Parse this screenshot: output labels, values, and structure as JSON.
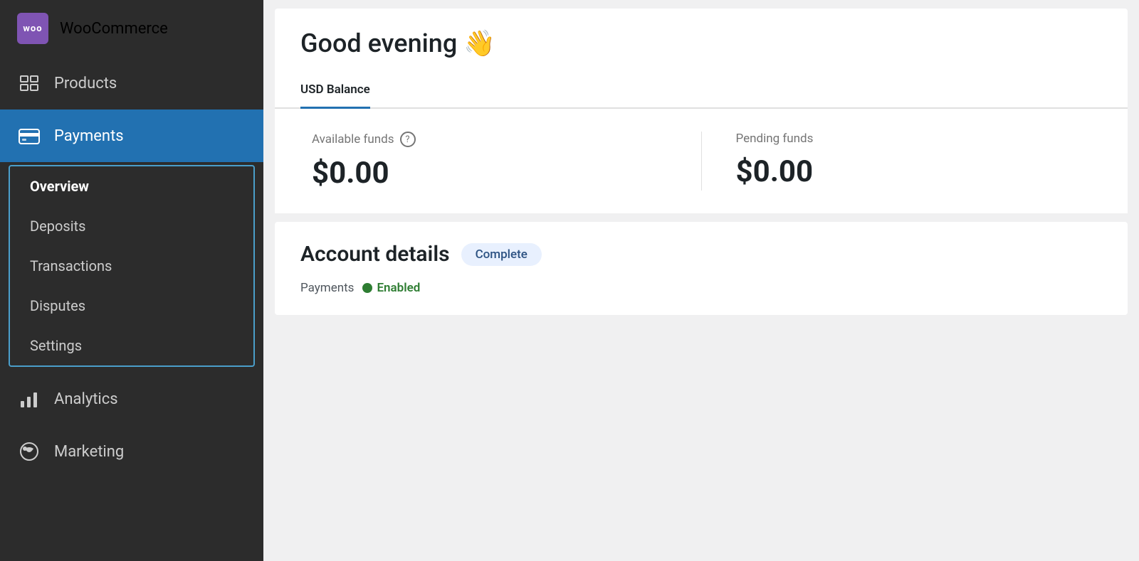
{
  "sidebar": {
    "logo": {
      "icon_label": "woo",
      "label": "WooCommerce"
    },
    "items": [
      {
        "id": "products",
        "label": "Products",
        "icon": "products-icon",
        "active": false
      },
      {
        "id": "payments",
        "label": "Payments",
        "icon": "payments-icon",
        "active": true
      },
      {
        "id": "analytics",
        "label": "Analytics",
        "icon": "analytics-icon",
        "active": false
      },
      {
        "id": "marketing",
        "label": "Marketing",
        "icon": "marketing-icon",
        "active": false
      }
    ],
    "submenu": {
      "items": [
        {
          "id": "overview",
          "label": "Overview",
          "active": true
        },
        {
          "id": "deposits",
          "label": "Deposits",
          "active": false
        },
        {
          "id": "transactions",
          "label": "Transactions",
          "active": false
        },
        {
          "id": "disputes",
          "label": "Disputes",
          "active": false
        },
        {
          "id": "settings",
          "label": "Settings",
          "active": false
        }
      ]
    }
  },
  "main": {
    "greeting": "Good evening 👋",
    "tabs": [
      {
        "id": "usd-balance",
        "label": "USD Balance",
        "active": true
      }
    ],
    "balance": {
      "available_funds_label": "Available funds",
      "available_funds_amount": "$0.00",
      "pending_funds_label": "Pending funds",
      "pending_funds_amount": "$0.00",
      "help_icon_label": "?"
    },
    "account_details": {
      "title": "Account details",
      "badge": "Complete",
      "payments_label": "Payments",
      "payments_status": "Enabled"
    }
  }
}
